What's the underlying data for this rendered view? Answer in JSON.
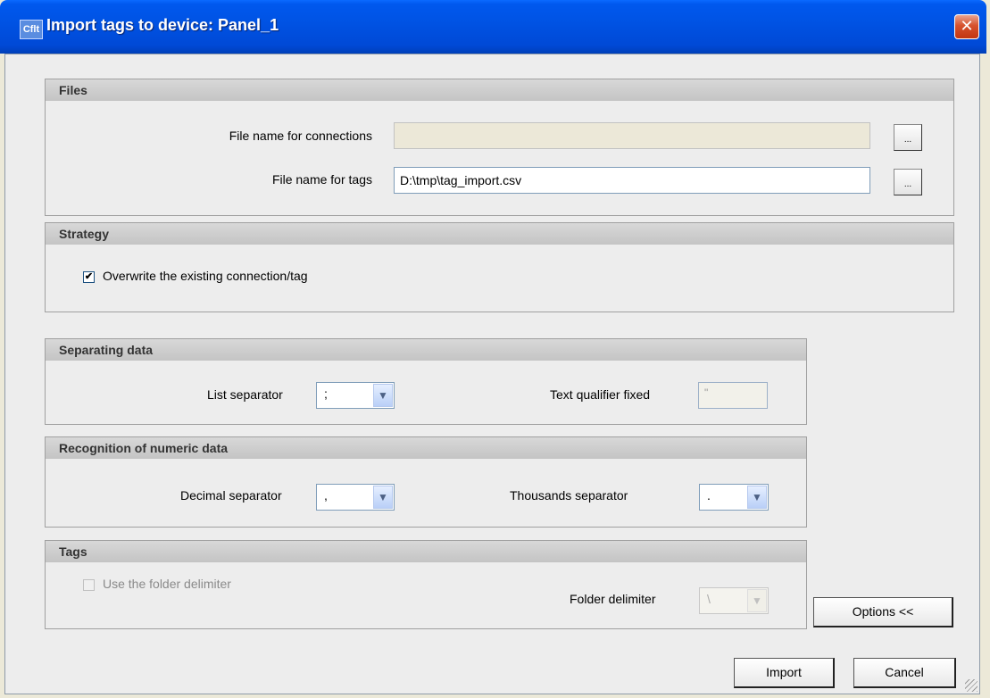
{
  "window": {
    "title": "Import tags to device: Panel_1",
    "app_icon_text": "Cflt",
    "close_glyph": "✕"
  },
  "files": {
    "header": "Files",
    "connections_label": "File name for connections",
    "connections_value": "",
    "tags_label": "File name for tags",
    "tags_value": "D:\\tmp\\tag_import.csv",
    "browse_label": "..."
  },
  "strategy": {
    "header": "Strategy",
    "overwrite_label": "Overwrite the existing connection/tag",
    "overwrite_checked": true
  },
  "separating": {
    "header": "Separating data",
    "list_separator_label": "List separator",
    "list_separator_value": ";",
    "text_qualifier_label": "Text qualifier fixed",
    "text_qualifier_value": "\""
  },
  "numeric": {
    "header": "Recognition of numeric data",
    "decimal_label": "Decimal separator",
    "decimal_value": ",",
    "thousands_label": "Thousands separator",
    "thousands_value": "."
  },
  "tags": {
    "header": "Tags",
    "use_delimiter_label": "Use the folder delimiter",
    "use_delimiter_checked": false,
    "folder_delimiter_label": "Folder delimiter",
    "folder_delimiter_value": "\\"
  },
  "buttons": {
    "options": "Options <<",
    "import": "Import",
    "cancel": "Cancel"
  },
  "icons": {
    "check": "✔",
    "dropdown": "▼"
  }
}
